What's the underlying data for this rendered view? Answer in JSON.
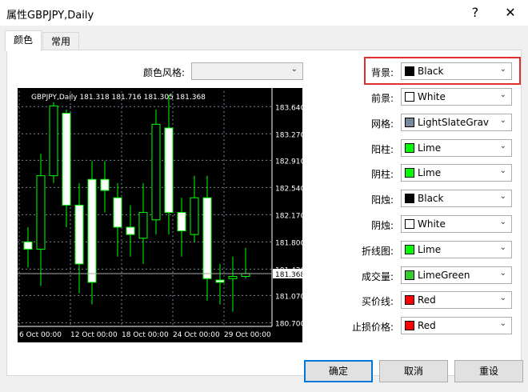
{
  "window": {
    "title": "属性GBPJPY,Daily",
    "help": "?",
    "close": "✕"
  },
  "tabs": [
    {
      "label": "颜色"
    },
    {
      "label": "常用"
    }
  ],
  "color_style": {
    "label": "颜色风格:",
    "value": ""
  },
  "settings": [
    {
      "label": "背景:",
      "value": "Black",
      "color": "#000000"
    },
    {
      "label": "前景:",
      "value": "White",
      "color": "#ffffff"
    },
    {
      "label": "网格:",
      "value": "LightSlateGrav",
      "color": "#778899"
    },
    {
      "label": "阳柱:",
      "value": "Lime",
      "color": "#00ff00"
    },
    {
      "label": "阴柱:",
      "value": "Lime",
      "color": "#00ff00"
    },
    {
      "label": "阳烛:",
      "value": "Black",
      "color": "#000000"
    },
    {
      "label": "阴烛:",
      "value": "White",
      "color": "#ffffff"
    },
    {
      "label": "折线图:",
      "value": "Lime",
      "color": "#00ff00"
    },
    {
      "label": "成交量:",
      "value": "LimeGreen",
      "color": "#32cd32"
    },
    {
      "label": "买价线:",
      "value": "Red",
      "color": "#ff0000"
    },
    {
      "label": "止损价格:",
      "value": "Red",
      "color": "#ff0000"
    }
  ],
  "buttons": {
    "ok": "确定",
    "cancel": "取消",
    "reset": "重设"
  },
  "chart_data": {
    "type": "candlestick",
    "header": "GBPJPY,Daily  181.318 181.716 181.305 181.368",
    "y_ticks": [
      "183.640",
      "183.270",
      "182.910",
      "182.540",
      "182.170",
      "181.800",
      "181.430",
      "181.070",
      "180.700"
    ],
    "current_price": "181.368",
    "x_ticks": [
      "6 Oct 00:00",
      "12 Oct 00:00",
      "18 Oct 00:00",
      "24 Oct 00:00",
      "29 Oct 00:00"
    ],
    "ylim": [
      180.65,
      183.85
    ],
    "candles": [
      {
        "o": 181.8,
        "c": 181.7,
        "h": 182.0,
        "l": 181.45
      },
      {
        "o": 181.7,
        "c": 182.7,
        "h": 183.0,
        "l": 181.2
      },
      {
        "o": 182.7,
        "c": 183.65,
        "h": 183.7,
        "l": 182.6
      },
      {
        "o": 183.55,
        "c": 182.3,
        "h": 183.6,
        "l": 182.0
      },
      {
        "o": 182.3,
        "c": 181.5,
        "h": 182.6,
        "l": 181.1
      },
      {
        "o": 182.65,
        "c": 181.25,
        "h": 182.9,
        "l": 180.95
      },
      {
        "o": 182.65,
        "c": 182.5,
        "h": 182.9,
        "l": 182.2
      },
      {
        "o": 182.4,
        "c": 182.0,
        "h": 182.6,
        "l": 181.6
      },
      {
        "o": 182.0,
        "c": 181.9,
        "h": 182.3,
        "l": 181.6
      },
      {
        "o": 181.85,
        "c": 182.2,
        "h": 182.6,
        "l": 181.5
      },
      {
        "o": 182.1,
        "c": 183.4,
        "h": 183.6,
        "l": 181.9
      },
      {
        "o": 183.35,
        "c": 182.2,
        "h": 183.8,
        "l": 181.9
      },
      {
        "o": 182.2,
        "c": 181.95,
        "h": 182.4,
        "l": 181.6
      },
      {
        "o": 181.9,
        "c": 182.4,
        "h": 182.7,
        "l": 181.8
      },
      {
        "o": 182.4,
        "c": 181.3,
        "h": 182.7,
        "l": 181.0
      },
      {
        "o": 181.28,
        "c": 181.25,
        "h": 181.5,
        "l": 180.95
      },
      {
        "o": 181.3,
        "c": 181.33,
        "h": 181.6,
        "l": 180.85
      },
      {
        "o": 181.33,
        "c": 181.37,
        "h": 181.72,
        "l": 181.3
      }
    ]
  }
}
